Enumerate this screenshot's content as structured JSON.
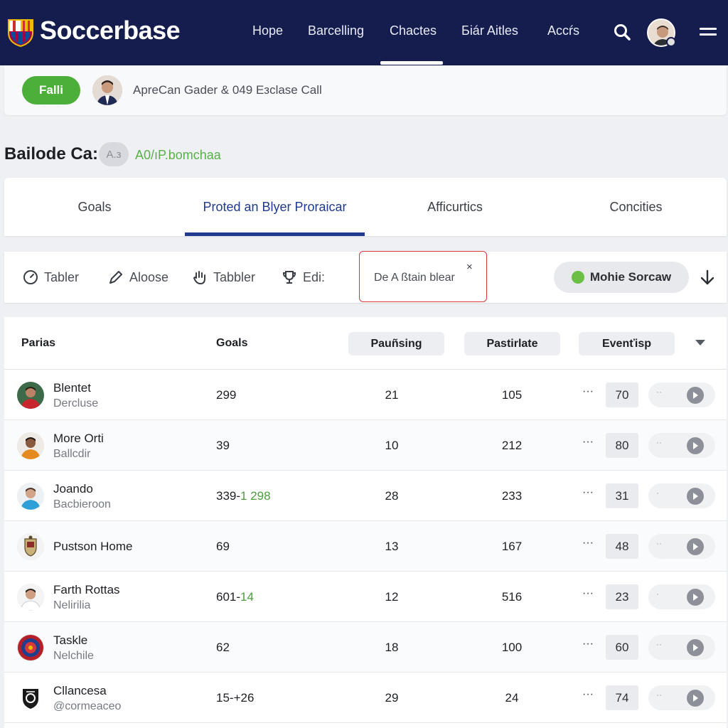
{
  "app": {
    "brand": "Soccerbase"
  },
  "nav": {
    "links": [
      "Hope",
      "Barcelling",
      "Chactes",
      "Біár Aitles",
      "Accŕs"
    ],
    "active_index": 2
  },
  "banner": {
    "pill_label": "Falli",
    "text": "ApreCan Gader & 049 Eзclase Call"
  },
  "section": {
    "title": "Bailode Cа:",
    "badge": "A.з",
    "link": "A0/ıP.bomchaa"
  },
  "tabs": [
    {
      "label": "Goals"
    },
    {
      "label": "Proted an Blyer Proraicar"
    },
    {
      "label": "Afficurtics"
    },
    {
      "label": "Concities"
    }
  ],
  "active_tab": 1,
  "toolbar": {
    "tools": [
      {
        "label": "Tabler",
        "icon": "gauge-icon"
      },
      {
        "label": "Aloose",
        "icon": "pen-icon"
      },
      {
        "label": "Tabbler",
        "icon": "hand-icon"
      },
      {
        "label": "Edi:",
        "icon": "trophy-icon"
      }
    ],
    "filter_text": "De A ßtain blear",
    "filter_close": "×",
    "mobile_label": "Mohie Sorcaw"
  },
  "table": {
    "headers": {
      "players": "Parias",
      "goals": "Goals",
      "col3": "Pauñsing",
      "col4": "Pastirlate",
      "col5": "Evenťisp"
    },
    "rows": [
      {
        "name": "Blentet",
        "sub": "Dercluse",
        "goals": "299",
        "goals_accent": "",
        "c3": "21",
        "c4": "105",
        "dots": "···",
        "val": "70",
        "pill": "··",
        "avatar": "player-red"
      },
      {
        "name": "More Orti",
        "sub": "Ballcdir",
        "goals": "39",
        "goals_accent": "",
        "c3": "10",
        "c4": "212",
        "dots": "···",
        "val": "80",
        "pill": "··",
        "avatar": "player-orange"
      },
      {
        "name": "Joando",
        "sub": "Bacbieroon",
        "goals": "339-",
        "goals_accent": "1 298",
        "c3": "28",
        "c4": "233",
        "dots": "···",
        "val": "31",
        "pill": "·",
        "avatar": "player-blue"
      },
      {
        "name": "Pustson Home",
        "sub": "",
        "goals": "69",
        "goals_accent": "",
        "c3": "13",
        "c4": "167",
        "dots": "···",
        "val": "48",
        "pill": "··",
        "avatar": "crest"
      },
      {
        "name": "Farth Rottas",
        "sub": "Nelirilia",
        "goals": "601-",
        "goals_accent": "14",
        "c3": "12",
        "c4": "516",
        "dots": "···",
        "val": "23",
        "pill": "·",
        "avatar": "player-white"
      },
      {
        "name": "Taskle",
        "sub": "Nelchile",
        "goals": "62",
        "goals_accent": "",
        "c3": "18",
        "c4": "100",
        "dots": "···",
        "val": "60",
        "pill": "··",
        "avatar": "badge-red"
      },
      {
        "name": "Cllancesa",
        "sub": "@cormeaceo",
        "goals": "15-+26",
        "goals_accent": "",
        "c3": "29",
        "c4": "24",
        "dots": "···",
        "val": "74",
        "pill": "··",
        "avatar": "badge-black"
      }
    ]
  },
  "colors": {
    "nav_bg": "#141d4d",
    "accent_blue": "#1f3a8f",
    "accent_green": "#4caf3a",
    "alert_red": "#d9383b"
  }
}
